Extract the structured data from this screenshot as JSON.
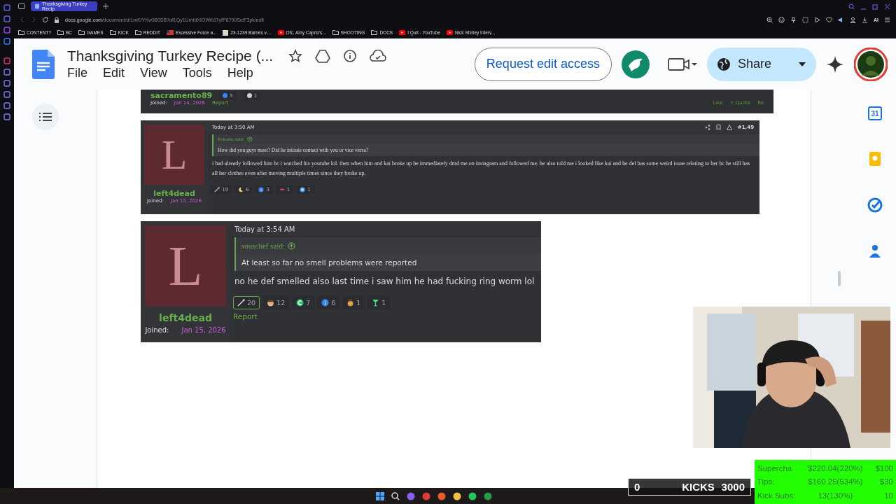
{
  "browser": {
    "tab_title": "Thanksgiving Turkey Recip",
    "url_host": "docs.google.com",
    "url_path": "/document/d/1mKfYKw380SB7af1Qy1UmfdXIOWK67yfP6790SctF3pk/edit",
    "bookmarks": [
      {
        "kind": "folder",
        "label": "CONTENT?"
      },
      {
        "kind": "folder",
        "label": "BC"
      },
      {
        "kind": "folder",
        "label": "GAMES"
      },
      {
        "kind": "folder",
        "label": "KICK"
      },
      {
        "kind": "folder",
        "label": "REDDIT"
      },
      {
        "kind": "flag",
        "label": "Excessive Force a..."
      },
      {
        "kind": "page",
        "label": "23-1239 Barnes v...."
      },
      {
        "kind": "video",
        "label": "Ofc. Amy Caprio's..."
      },
      {
        "kind": "folder",
        "label": "SHOOTING"
      },
      {
        "kind": "folder",
        "label": "DOCS"
      },
      {
        "kind": "video",
        "label": "I Quit - YouTube"
      },
      {
        "kind": "video",
        "label": "Nick Shirley Interv..."
      }
    ],
    "toolbar_extra": "AI"
  },
  "doc": {
    "title": "Thanksgiving Turkey Recipe (...",
    "menus": [
      "File",
      "Edit",
      "View",
      "Tools",
      "Help"
    ],
    "request_button": "Request edit access",
    "share_button": "Share",
    "calendar_day": "31"
  },
  "posts": [
    {
      "kind": "cut",
      "username": "sacramento89",
      "joined_label": "Joined:",
      "joined_date": "Jan 14, 2026",
      "report": "Report",
      "reactions": [
        {
          "kind": "info",
          "count": "5",
          "selected": false
        },
        {
          "kind": "wand",
          "count": "1",
          "selected": false
        }
      ],
      "links": [
        "Like",
        "+ Quote",
        "Re"
      ]
    },
    {
      "kind": "compact",
      "avatar_letter": "L",
      "username": "left4dead",
      "joined_label": "Joined:",
      "joined_date": "Jan 15, 2026",
      "time": "Today at 3:50 AM",
      "post_number": "#1,49",
      "quote_author": "Polentic said:",
      "quote_text": "How did you guys meet? Did he initiate contact with you or vice versa?",
      "message": "i had already followed him bc i watched his youtube lol. then when him and kai broke up he immediately dmd me on instagram and followed me. he also told me i looked like kai and he def has some weird issue relating to her bc he still has all her clothes even after moving multiple times since they broke up.",
      "reactions": [
        {
          "kind": "wand",
          "count": "19",
          "selected": false
        },
        {
          "kind": "moon",
          "count": "6",
          "selected": false
        },
        {
          "kind": "info",
          "count": "3",
          "selected": false
        },
        {
          "kind": "lips",
          "count": "1",
          "selected": false
        },
        {
          "kind": "bubble",
          "count": "1",
          "selected": false
        }
      ]
    },
    {
      "kind": "large",
      "avatar_letter": "L",
      "username": "left4dead",
      "joined_label": "Joined:",
      "joined_date": "Jan 15, 2026",
      "time": "Today at 3:54 AM",
      "report": "Report",
      "quote_author": "souschef said:",
      "quote_text": "At least so far no smell problems were reported",
      "message": "no he def smelled also last time i saw him he had fucking ring worm lol",
      "reactions": [
        {
          "kind": "wand",
          "count": "20",
          "selected": true
        },
        {
          "kind": "face",
          "count": "12",
          "selected": false
        },
        {
          "kind": "c",
          "count": "7",
          "selected": false
        },
        {
          "kind": "info",
          "count": "6",
          "selected": false
        },
        {
          "kind": "medal",
          "count": "1",
          "selected": false
        },
        {
          "kind": "cocktail",
          "count": "1",
          "selected": false
        }
      ]
    }
  ],
  "stream": {
    "kicks": {
      "current": "0",
      "label": "KICKS",
      "goal": "3000"
    },
    "goals": [
      {
        "label": "Supercha",
        "value": "$220.04(220%)",
        "target": "$100"
      },
      {
        "label": "Tips:",
        "value": "$160.25(534%)",
        "target": "$30"
      },
      {
        "label": "Kick Subs:",
        "value": "13(130%)",
        "target": "10"
      }
    ]
  }
}
